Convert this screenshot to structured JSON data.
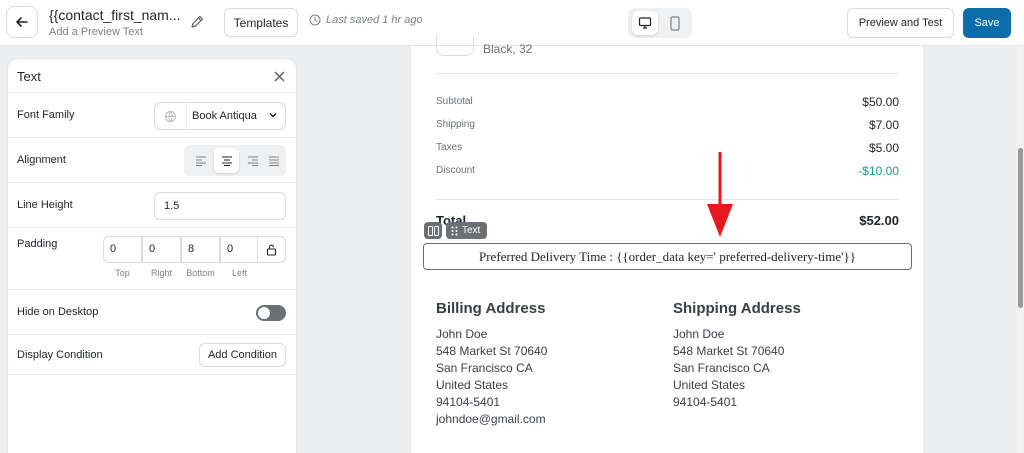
{
  "header": {
    "title": "{{contact_first_nam...",
    "subtitle": "Add a Preview Text",
    "templates_label": "Templates",
    "last_saved": "Last saved 1 hr ago",
    "preview_label": "Preview and Test",
    "save_label": "Save",
    "active_device": "desktop",
    "accent_color": "#0d6dab"
  },
  "panel": {
    "title": "Text",
    "font_family": {
      "label": "Font Family",
      "value": "Book Antiqua"
    },
    "alignment": {
      "label": "Alignment",
      "options": [
        "left",
        "center",
        "right",
        "justify"
      ],
      "selected": "center"
    },
    "line_height": {
      "label": "Line Height",
      "value": "1.5"
    },
    "padding": {
      "label": "Padding",
      "sides": [
        {
          "caption": "Top",
          "value": "0"
        },
        {
          "caption": "Right",
          "value": "0"
        },
        {
          "caption": "Bottom",
          "value": "8"
        },
        {
          "caption": "Left",
          "value": "0"
        }
      ]
    },
    "hide_on_desktop": {
      "label": "Hide on Desktop",
      "enabled": false
    },
    "display_condition": {
      "label": "Display Condition",
      "button": "Add Condition"
    }
  },
  "email": {
    "product_variant": "Black, 32",
    "summary": [
      {
        "label": "Subtotal",
        "value": "$50.00"
      },
      {
        "label": "Shipping",
        "value": "$7.00"
      },
      {
        "label": "Taxes",
        "value": "$5.00"
      },
      {
        "label": "Discount",
        "value": "-$10.00"
      }
    ],
    "total_label": "Total",
    "total_value": "$52.00",
    "block_tag": "Text",
    "delivery_text": "Preferred Delivery Time : {{order_data key=' preferred-delivery-time'}}",
    "billing": {
      "heading": "Billing Address",
      "lines": [
        "John Doe",
        "548 Market St 70640",
        "San Francisco CA",
        "United States",
        "94104-5401",
        "johndoe@gmail.com"
      ]
    },
    "shipping": {
      "heading": "Shipping Address",
      "lines": [
        "John Doe",
        "548 Market St 70640",
        "San Francisco CA",
        "United States",
        "94104-5401"
      ]
    },
    "discount_color": "#1aa08a",
    "annotation_color": "#e8191c"
  }
}
